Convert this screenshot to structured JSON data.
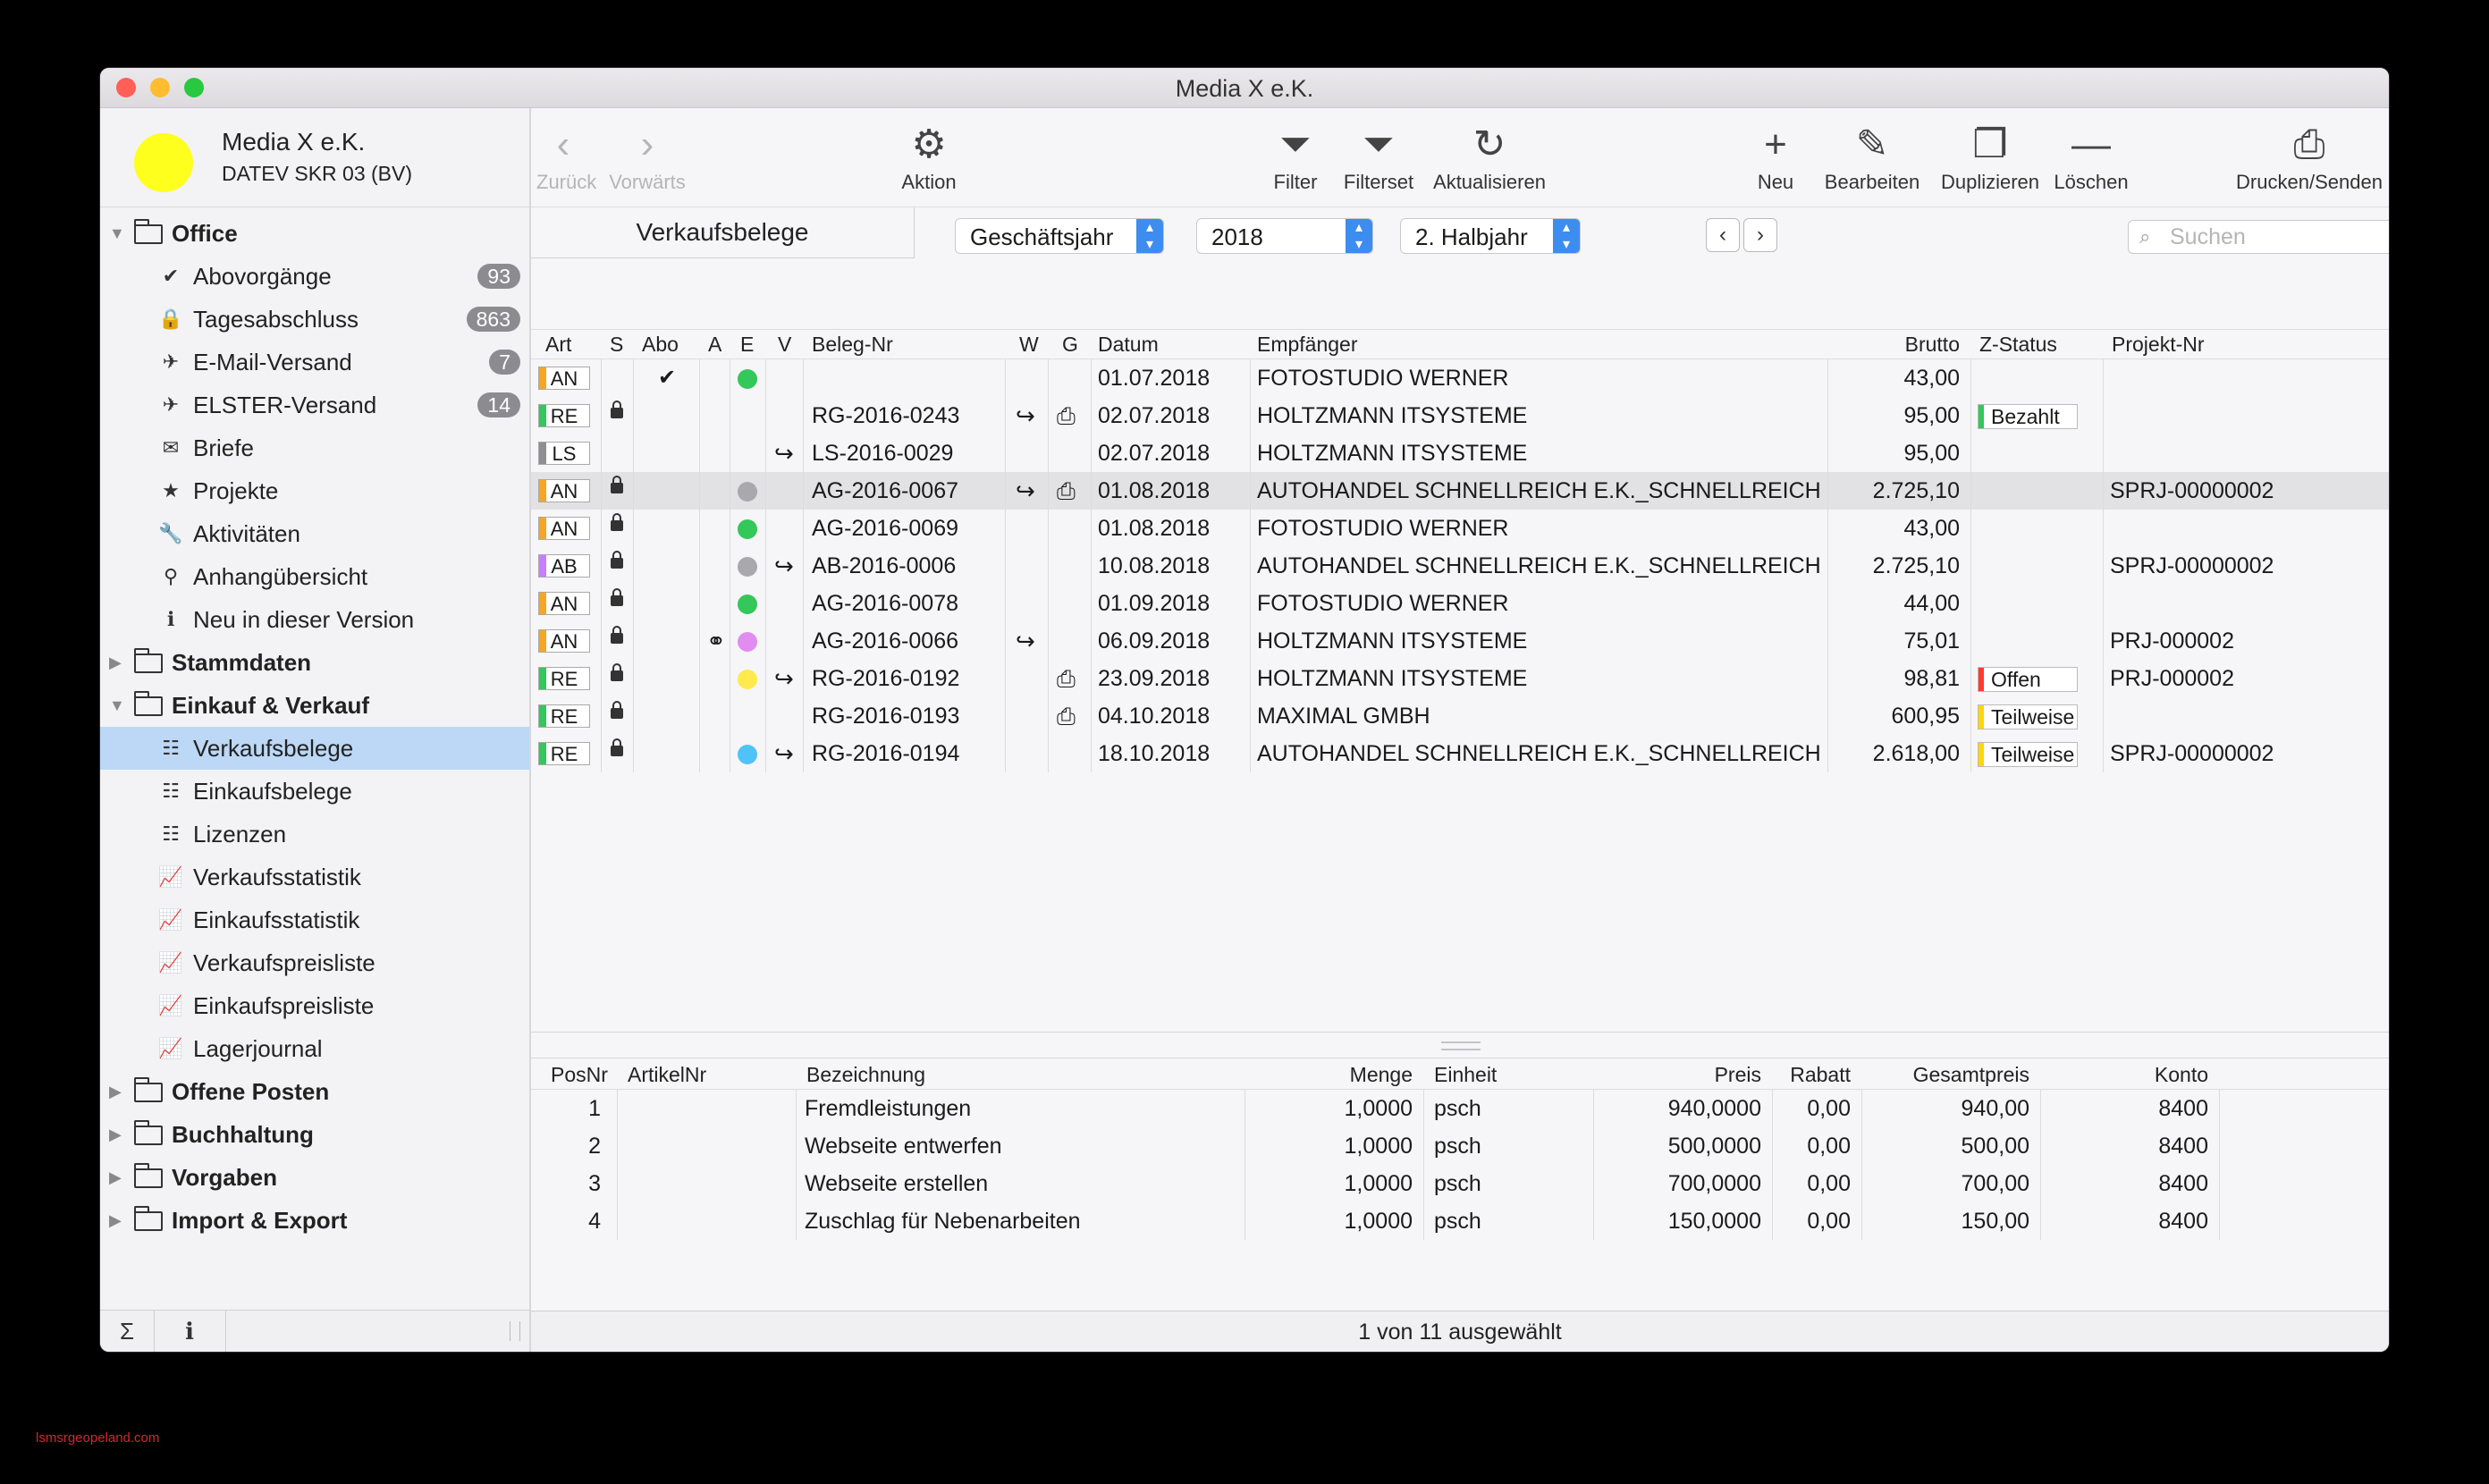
{
  "window": {
    "title": "Media X e.K.",
    "lights": {
      "close": "#fe5f57",
      "minimize": "#febc2e",
      "zoom": "#28c840"
    }
  },
  "company": {
    "name": "Media X e.K.",
    "sub": "DATEV SKR 03 (BV)",
    "color": "#ffff1e"
  },
  "sidebar": {
    "office": {
      "label": "Office",
      "items": [
        {
          "label": "Abovorgänge",
          "icon": "checkmark-icon",
          "glyph": "✔",
          "badge": "93"
        },
        {
          "label": "Tagesabschluss",
          "icon": "lock-icon",
          "glyph": "🔒",
          "badge": "863"
        },
        {
          "label": "E-Mail-Versand",
          "icon": "paper-plane-icon",
          "glyph": "✈",
          "badge": "7"
        },
        {
          "label": "ELSTER-Versand",
          "icon": "paper-plane-icon",
          "glyph": "✈",
          "badge": "14"
        },
        {
          "label": "Briefe",
          "icon": "envelope-icon",
          "glyph": "✉",
          "badge": ""
        },
        {
          "label": "Projekte",
          "icon": "star-icon",
          "glyph": "★",
          "badge": ""
        },
        {
          "label": "Aktivitäten",
          "icon": "wrench-icon",
          "glyph": "🔧",
          "badge": ""
        },
        {
          "label": "Anhangübersicht",
          "icon": "paperclip-icon",
          "glyph": "⚲",
          "badge": ""
        },
        {
          "label": "Neu in dieser Version",
          "icon": "info-icon",
          "glyph": "ℹ",
          "badge": ""
        }
      ]
    },
    "stammdaten": {
      "label": "Stammdaten"
    },
    "einkauf": {
      "label": "Einkauf & Verkauf",
      "items": [
        {
          "label": "Verkaufsbelege",
          "icon": "list-icon",
          "glyph": "☷"
        },
        {
          "label": "Einkaufsbelege",
          "icon": "list-icon",
          "glyph": "☷"
        },
        {
          "label": "Lizenzen",
          "icon": "list-icon",
          "glyph": "☷"
        },
        {
          "label": "Verkaufsstatistik",
          "icon": "chart-line-icon",
          "glyph": "📈"
        },
        {
          "label": "Einkaufsstatistik",
          "icon": "chart-line-icon",
          "glyph": "📈"
        },
        {
          "label": "Verkaufspreisliste",
          "icon": "chart-line-icon",
          "glyph": "📈"
        },
        {
          "label": "Einkaufspreisliste",
          "icon": "chart-line-icon",
          "glyph": "📈"
        },
        {
          "label": "Lagerjournal",
          "icon": "chart-line-icon",
          "glyph": "📈"
        }
      ]
    },
    "offeneposten": {
      "label": "Offene Posten"
    },
    "buchhaltung": {
      "label": "Buchhaltung"
    },
    "vorgaben": {
      "label": "Vorgaben"
    },
    "import": {
      "label": "Import & Export"
    },
    "bottom": {
      "sum": "Σ",
      "info": "ℹ"
    }
  },
  "toolbar": {
    "back": "Zurück",
    "forward": "Vorwärts",
    "action": "Aktion",
    "filter": "Filter",
    "filterset": "Filterset",
    "refresh": "Aktualisieren",
    "new": "Neu",
    "edit": "Bearbeiten",
    "duplicate": "Duplizieren",
    "delete": "Löschen",
    "print": "Drucken/Senden"
  },
  "filterbar": {
    "tab": "Verkaufsbelege",
    "period_type": "Geschäftsjahr",
    "year": "2018",
    "half": "2. Halbjahr",
    "search_placeholder": "Suchen"
  },
  "belege": {
    "columns": {
      "art": "Art",
      "s": "S",
      "abo": "Abo",
      "a": "A",
      "e": "E",
      "v": "V",
      "nr": "Beleg-Nr",
      "w": "W",
      "g": "G",
      "datum": "Datum",
      "empf": "Empfänger",
      "brutto": "Brutto",
      "zstatus": "Z-Status",
      "projekt": "Projekt-Nr"
    },
    "art_colors": {
      "AN": "#f6a623",
      "RE": "#34c759",
      "LS": "#8e8e93",
      "AB": "#c77dff"
    },
    "status_colors": {
      "Bezahlt": "#34c759",
      "Offen": "#ff3b30",
      "Teilweise": "#ffd60a"
    },
    "rows": [
      {
        "art": "AN",
        "lock": false,
        "abo": "✔",
        "attach": false,
        "dot": "#34c759",
        "fwd": false,
        "nr": "",
        "w": false,
        "g": false,
        "datum": "01.07.2018",
        "empf": "FOTOSTUDIO WERNER",
        "brutto": "43,00",
        "zstatus": "",
        "projekt": ""
      },
      {
        "art": "RE",
        "lock": true,
        "abo": "",
        "attach": false,
        "dot": "",
        "fwd": false,
        "nr": "RG-2016-0243",
        "w": true,
        "g": true,
        "datum": "02.07.2018",
        "empf": "HOLTZMANN ITSYSTEME",
        "brutto": "95,00",
        "zstatus": "Bezahlt",
        "projekt": ""
      },
      {
        "art": "LS",
        "lock": false,
        "abo": "",
        "attach": false,
        "dot": "",
        "fwd": true,
        "nr": "LS-2016-0029",
        "w": false,
        "g": false,
        "datum": "02.07.2018",
        "empf": "HOLTZMANN ITSYSTEME",
        "brutto": "95,00",
        "zstatus": "",
        "projekt": ""
      },
      {
        "art": "AN",
        "lock": true,
        "abo": "",
        "attach": false,
        "dot": "#a9a9ad",
        "fwd": false,
        "nr": "AG-2016-0067",
        "w": true,
        "g": true,
        "datum": "01.08.2018",
        "empf": "AUTOHANDEL SCHNELLREICH E.K._SCHNELLREICH_...",
        "brutto": "2.725,10",
        "zstatus": "",
        "projekt": "SPRJ-00000002",
        "hl": true
      },
      {
        "art": "AN",
        "lock": true,
        "abo": "",
        "attach": false,
        "dot": "#34c759",
        "fwd": false,
        "nr": "AG-2016-0069",
        "w": false,
        "g": false,
        "datum": "01.08.2018",
        "empf": "FOTOSTUDIO WERNER",
        "brutto": "43,00",
        "zstatus": "",
        "projekt": ""
      },
      {
        "art": "AB",
        "lock": true,
        "abo": "",
        "attach": false,
        "dot": "#a9a9ad",
        "fwd": true,
        "nr": "AB-2016-0006",
        "w": false,
        "g": false,
        "datum": "10.08.2018",
        "empf": "AUTOHANDEL SCHNELLREICH E.K._SCHNELLREICH_...",
        "brutto": "2.725,10",
        "zstatus": "",
        "projekt": "SPRJ-00000002"
      },
      {
        "art": "AN",
        "lock": true,
        "abo": "",
        "attach": false,
        "dot": "#34c759",
        "fwd": false,
        "nr": "AG-2016-0078",
        "w": false,
        "g": false,
        "datum": "01.09.2018",
        "empf": "FOTOSTUDIO WERNER",
        "brutto": "44,00",
        "zstatus": "",
        "projekt": ""
      },
      {
        "art": "AN",
        "lock": true,
        "abo": "",
        "attach": true,
        "dot": "#e08cf0",
        "fwd": false,
        "nr": "AG-2016-0066",
        "w": true,
        "g": false,
        "datum": "06.09.2018",
        "empf": "HOLTZMANN ITSYSTEME",
        "brutto": "75,01",
        "zstatus": "",
        "projekt": "PRJ-000002"
      },
      {
        "art": "RE",
        "lock": true,
        "abo": "",
        "attach": false,
        "dot": "#ffe94d",
        "fwd": true,
        "nr": "RG-2016-0192",
        "w": false,
        "g": true,
        "datum": "23.09.2018",
        "empf": "HOLTZMANN ITSYSTEME",
        "brutto": "98,81",
        "zstatus": "Offen",
        "projekt": "PRJ-000002"
      },
      {
        "art": "RE",
        "lock": true,
        "abo": "",
        "attach": false,
        "dot": "",
        "fwd": false,
        "nr": "RG-2016-0193",
        "w": false,
        "g": true,
        "datum": "04.10.2018",
        "empf": "MAXIMAL GMBH",
        "brutto": "600,95",
        "zstatus": "Teilweise",
        "projekt": ""
      },
      {
        "art": "RE",
        "lock": true,
        "abo": "",
        "attach": false,
        "dot": "#4fc3f7",
        "fwd": true,
        "nr": "RG-2016-0194",
        "w": false,
        "g": false,
        "datum": "18.10.2018",
        "empf": "AUTOHANDEL SCHNELLREICH E.K._SCHNELLREICH_...",
        "brutto": "2.618,00",
        "zstatus": "Teilweise",
        "projekt": "SPRJ-00000002"
      }
    ]
  },
  "positionen": {
    "columns": {
      "pos": "PosNr",
      "artikel": "ArtikelNr",
      "bez": "Bezeichnung",
      "menge": "Menge",
      "einheit": "Einheit",
      "preis": "Preis",
      "rabatt": "Rabatt",
      "gesamt": "Gesamtpreis",
      "konto": "Konto"
    },
    "rows": [
      {
        "pos": "1",
        "artikel": "",
        "bez": "Fremdleistungen",
        "menge": "1,0000",
        "einheit": "psch",
        "preis": "940,0000",
        "rabatt": "0,00",
        "gesamt": "940,00",
        "konto": "8400"
      },
      {
        "pos": "2",
        "artikel": "",
        "bez": "Webseite entwerfen",
        "menge": "1,0000",
        "einheit": "psch",
        "preis": "500,0000",
        "rabatt": "0,00",
        "gesamt": "500,00",
        "konto": "8400"
      },
      {
        "pos": "3",
        "artikel": "",
        "bez": "Webseite erstellen",
        "menge": "1,0000",
        "einheit": "psch",
        "preis": "700,0000",
        "rabatt": "0,00",
        "gesamt": "700,00",
        "konto": "8400"
      },
      {
        "pos": "4",
        "artikel": "",
        "bez": "Zuschlag für Nebenarbeiten",
        "menge": "1,0000",
        "einheit": "psch",
        "preis": "150,0000",
        "rabatt": "0,00",
        "gesamt": "150,00",
        "konto": "8400"
      }
    ]
  },
  "status": {
    "text": "1 von 11 ausgewählt"
  },
  "watermark": "lsmsrgeopeland.com"
}
